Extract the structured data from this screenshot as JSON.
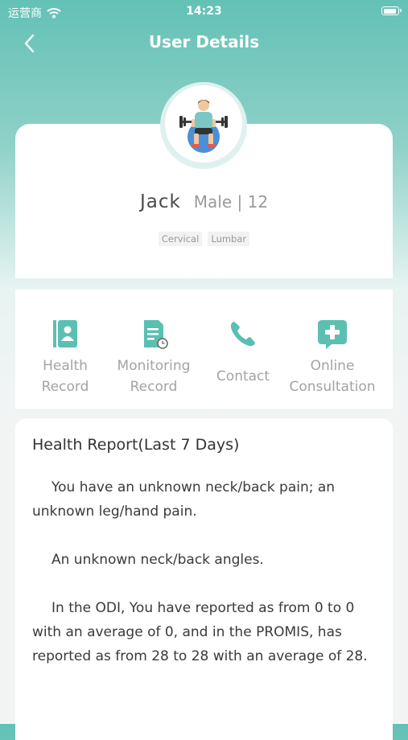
{
  "status": {
    "carrier": "运营商",
    "time": "14:23"
  },
  "nav": {
    "title": "User Details"
  },
  "profile": {
    "name": "Jack",
    "meta": "Male | 12",
    "tags": [
      "Cervical",
      "Lumbar"
    ]
  },
  "actions": [
    {
      "label_line1": "Health",
      "label_line2": "Record",
      "icon": "contact-book-icon"
    },
    {
      "label_line1": "Monitoring",
      "label_line2": "Record",
      "icon": "document-clock-icon"
    },
    {
      "label_line1": "Contact",
      "label_line2": "",
      "icon": "phone-icon"
    },
    {
      "label_line1": "Online",
      "label_line2": "Consultation",
      "icon": "medical-chat-icon"
    }
  ],
  "report": {
    "title": "Health Report(Last 7 Days)",
    "paragraphs": [
      "You have an unknown neck/back pain; an unknown leg/hand pain.",
      "An unknown neck/back angles.",
      "In the ODI,  You have reported as from 0 to 0 with an average of 0, and in the PROMIS, has reported as from 28 to 28 with an average of 28."
    ]
  },
  "colors": {
    "accent": "#5bbfb2",
    "header": "#63c1b6"
  }
}
